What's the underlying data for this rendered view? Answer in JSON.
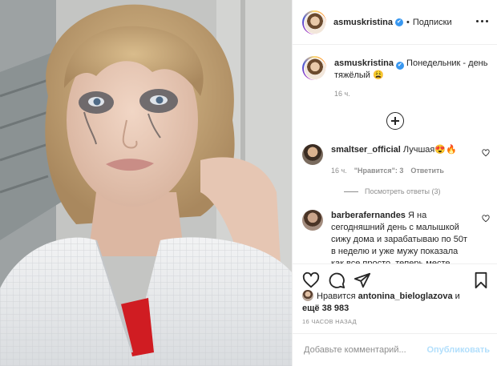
{
  "header": {
    "username": "asmuskristina",
    "verified_mark": "✔",
    "separator": "•",
    "follow_label": "Подписки",
    "more_icon": "more-horizontal-icon"
  },
  "caption": {
    "username": "asmuskristina",
    "verified_mark": "✔",
    "text": "Понедельник - день тяжёлый 😩",
    "time": "16 ч."
  },
  "load_more_icon": "plus-circle-icon",
  "comments": [
    {
      "username": "smaltser_official",
      "text": "Лучшая😍🔥",
      "time": "16 ч.",
      "likes": "\"Нравится\": 3",
      "reply_label": "Ответить",
      "view_replies": "Посмотреть ответы (3)"
    },
    {
      "username": "barberafernandes",
      "text": "Я на сегодняшний день с малышкой сижу дома и зарабатываю по 50т в неделю и уже мужу показала как все просто, теперь месте"
    }
  ],
  "actions": {
    "like_icon": "heart-icon",
    "comment_icon": "comment-icon",
    "share_icon": "paper-plane-icon",
    "save_icon": "bookmark-icon"
  },
  "likes": {
    "prefix": "Нравится",
    "user": "antonina_bieloglazova",
    "connector": "и",
    "others": "ещё 38 983"
  },
  "post_time": "16 ЧАСОВ НАЗАД",
  "add_comment": {
    "placeholder": "Добавьте комментарий...",
    "publish_label": "Опубликовать"
  },
  "colors": {
    "verified": "#3897f0",
    "publish_disabled": "#b2dffc",
    "muted": "#8e8e8e"
  }
}
